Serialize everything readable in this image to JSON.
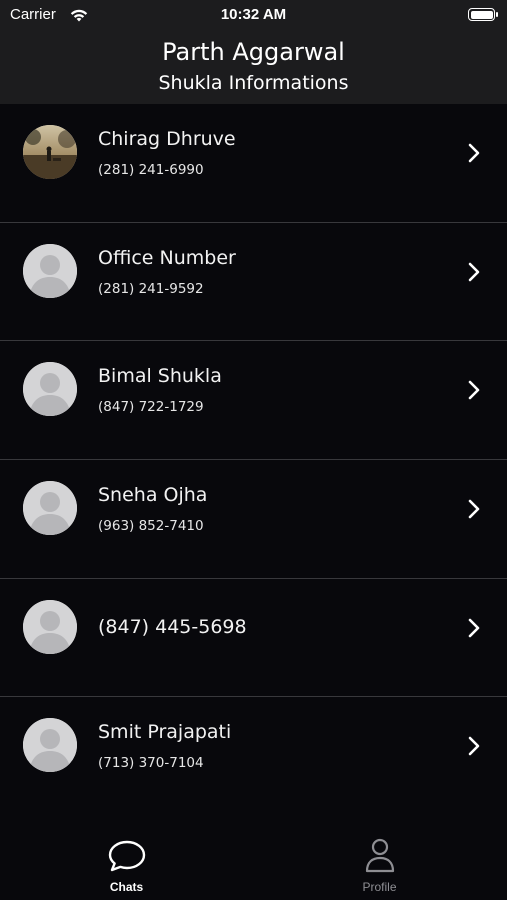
{
  "status_bar": {
    "carrier": "Carrier",
    "time": "10:32 AM",
    "battery_level": 1.0
  },
  "header": {
    "title": "Parth Aggarwal",
    "subtitle": "Shukla Informations"
  },
  "contacts": [
    {
      "name": "Chirag Dhruve",
      "phone": "(281) 241-6990",
      "avatar": "photo"
    },
    {
      "name": "Office Number",
      "phone": "(281) 241-9592",
      "avatar": "placeholder"
    },
    {
      "name": "Bimal Shukla",
      "phone": "(847) 722-1729",
      "avatar": "placeholder"
    },
    {
      "name": "Sneha Ojha",
      "phone": "(963) 852-7410",
      "avatar": "placeholder"
    },
    {
      "name": "(847) 445-5698",
      "phone": "",
      "avatar": "placeholder"
    },
    {
      "name": "Smit Prajapati",
      "phone": "(713) 370-7104",
      "avatar": "placeholder"
    }
  ],
  "tabbar": {
    "tabs": [
      {
        "label": "Chats",
        "icon": "chat-bubble-icon",
        "selected": true
      },
      {
        "label": "Profile",
        "icon": "person-icon",
        "selected": false
      }
    ]
  },
  "colors": {
    "background": "#08080c",
    "header_background": "#1c1c1e",
    "separator": "#38383c",
    "inactive_tab": "#8e8e93"
  }
}
